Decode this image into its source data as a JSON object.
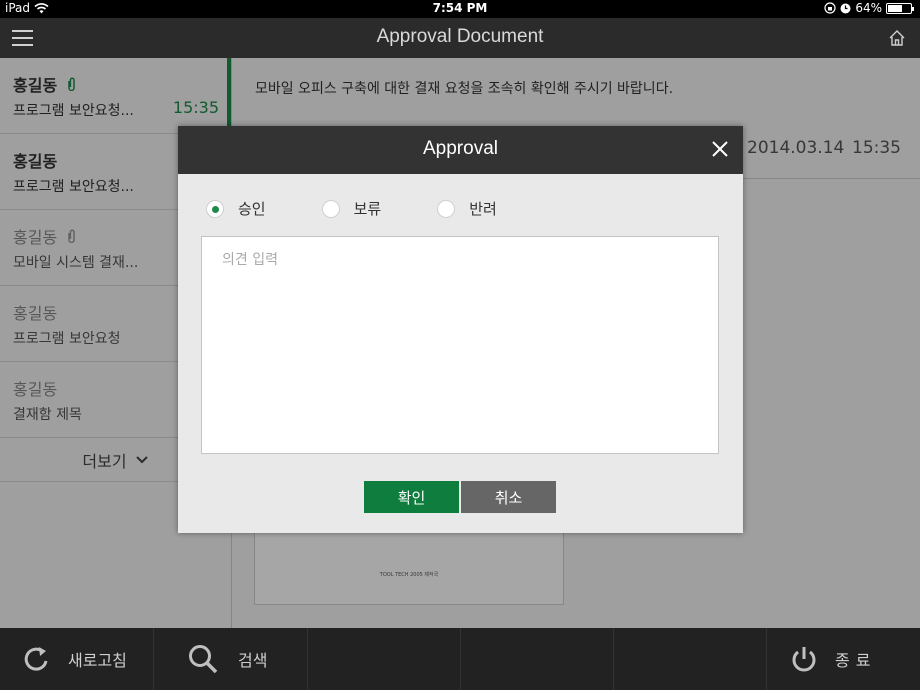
{
  "statusbar": {
    "device": "iPad",
    "time": "7:54 PM",
    "battery": "64%",
    "battery_level": 0.64
  },
  "header": {
    "title": "Approval Document"
  },
  "sidebar": {
    "items": [
      {
        "name": "홍길동",
        "subject": "프로그램 보안요청...",
        "time": "15:35",
        "attachment": true,
        "read": false
      },
      {
        "name": "홍길동",
        "subject": "프로그램 보안요청...",
        "time": "",
        "attachment": false,
        "read": false
      },
      {
        "name": "홍길동",
        "subject": "모바일 시스템 결재...",
        "time": "",
        "attachment": true,
        "read": true
      },
      {
        "name": "홍길동",
        "subject": "프로그램 보안요청",
        "time": "",
        "attachment": false,
        "read": true
      },
      {
        "name": "홍길동",
        "subject": "결재함 제목",
        "time": "",
        "attachment": false,
        "read": true
      }
    ],
    "more_label": "더보기"
  },
  "content": {
    "body": "모바일 오피스 구축에 대한 결재 요청을 조속히 확인해 주시기 바랍니다.",
    "date": "2014.03.14",
    "time": "15:35",
    "doc_stamp": "TOOL TECH 2005 제작국"
  },
  "dialog": {
    "title": "Approval",
    "options": [
      "승인",
      "보류",
      "반려"
    ],
    "selected": "승인",
    "placeholder": "의견 입력",
    "ok_label": "확인",
    "cancel_label": "취소"
  },
  "bottombar": {
    "refresh_label": "새로고침",
    "search_label": "검색",
    "exit_label": "종료"
  },
  "colors": {
    "accent": "#1c8a4a",
    "header": "#2b2b2b",
    "bottombar": "#222222",
    "cancel": "#666666"
  }
}
